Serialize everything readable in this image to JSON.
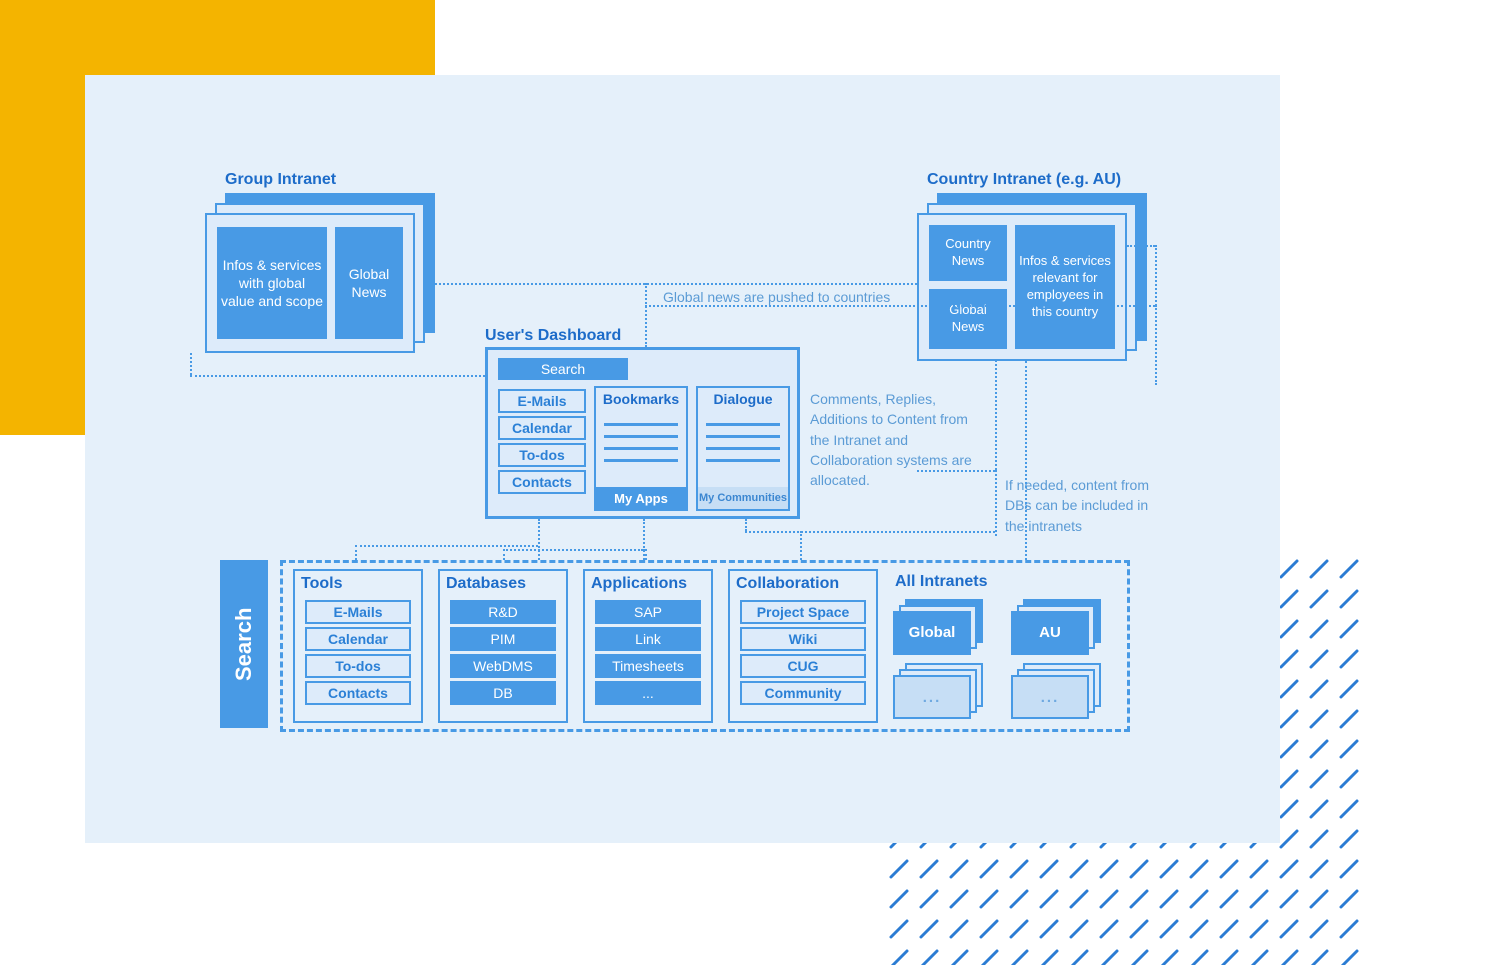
{
  "group_intranet": {
    "title": "Group Intranet",
    "box_infos": "Infos & services with global value and scope",
    "box_news": "Global News"
  },
  "country_intranet": {
    "title": "Country Intranet (e.g. AU)",
    "box_cnews": "Country News",
    "box_gnews": "Global News",
    "box_infos": "Infos & services relevant for employees in this country"
  },
  "dashboard": {
    "title": "User's Dashboard",
    "search": "Search",
    "col1": [
      "E-Mails",
      "Calendar",
      "To-dos",
      "Contacts"
    ],
    "col2_head": "Bookmarks",
    "col2_foot": "My Apps",
    "col3_head": "Dialogue",
    "col3_foot": "My Communities"
  },
  "notes": {
    "pushed": "Global news are pushed to countries",
    "comments": "Comments, Replies, Additions to Content from the Intranet and Collaboration systems are allocated.",
    "dbs": "If needed, content from DBs can be included in the intranets"
  },
  "bottom": {
    "search": "Search",
    "tools": {
      "title": "Tools",
      "items": [
        "E-Mails",
        "Calendar",
        "To-dos",
        "Contacts"
      ]
    },
    "databases": {
      "title": "Databases",
      "items": [
        "R&D",
        "PIM",
        "WebDMS",
        "DB"
      ]
    },
    "applications": {
      "title": "Applications",
      "items": [
        "SAP",
        "Link",
        "Timesheets",
        "..."
      ]
    },
    "collaboration": {
      "title": "Collaboration",
      "items": [
        "Project Space",
        "Wiki",
        "CUG",
        "Community"
      ]
    },
    "intranets": {
      "title": "All Intranets",
      "global": "Global",
      "au": "AU",
      "more": "..."
    }
  }
}
